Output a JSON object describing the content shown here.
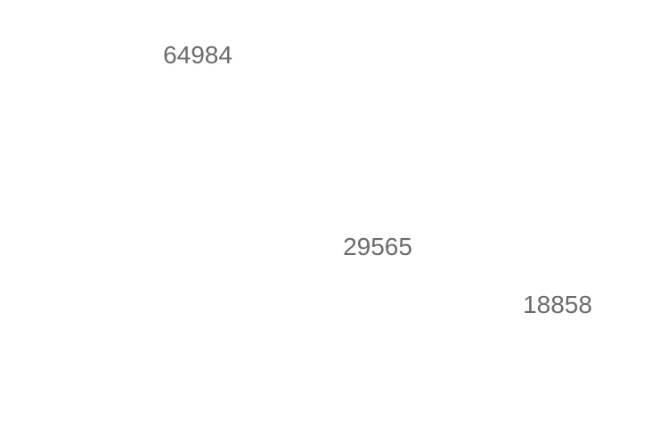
{
  "chart_data": {
    "type": "scatter",
    "title": "",
    "xlabel": "",
    "ylabel": "",
    "grid": false,
    "points": [
      {
        "label": "64984",
        "value": 64984
      },
      {
        "label": "29565",
        "value": 29565
      },
      {
        "label": "18858",
        "value": 18858
      }
    ],
    "label_color": "#6b6b6b",
    "background": "#ffffff"
  }
}
